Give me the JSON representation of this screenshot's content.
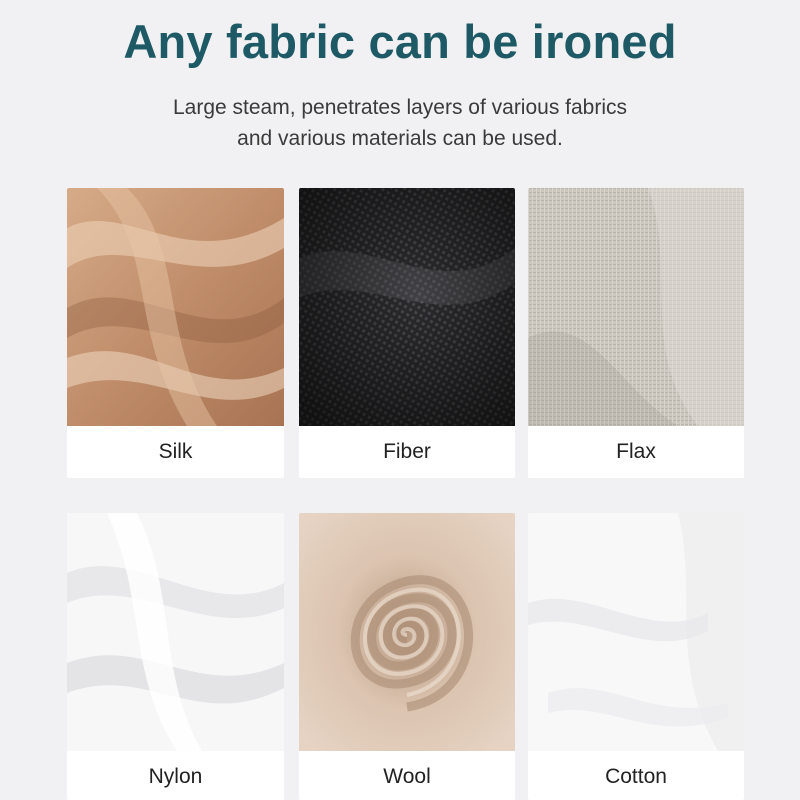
{
  "header": {
    "title": "Any fabric can be ironed",
    "subtitle_lines": [
      "Large steam, penetrates layers of various fabrics",
      "and various materials can be used."
    ]
  },
  "fabrics": [
    {
      "label": "Silk",
      "swatch": "silk"
    },
    {
      "label": "Fiber",
      "swatch": "fiber"
    },
    {
      "label": "Flax",
      "swatch": "flax"
    },
    {
      "label": "Nylon",
      "swatch": "nylon"
    },
    {
      "label": "Wool",
      "swatch": "wool"
    },
    {
      "label": "Cotton",
      "swatch": "cotton"
    }
  ],
  "colors": {
    "title": "#1e5a66",
    "background": "#f1f1f3",
    "silk": "#c99a78",
    "fiber": "#2d2d2f",
    "flax": "#c9c4bc",
    "wool": "#d9c1ad"
  }
}
